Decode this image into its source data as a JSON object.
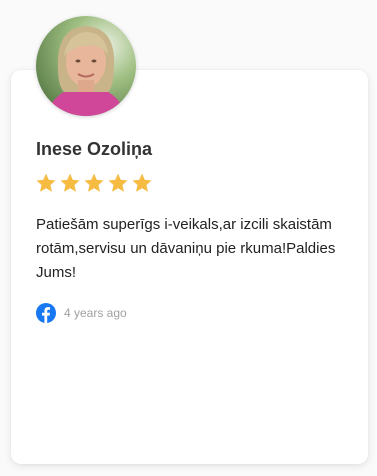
{
  "review": {
    "author_name": "Inese Ozoliņa",
    "rating": 5,
    "rating_max": 5,
    "text": "Patiešām superīgs i-veikals,ar izcili skaistām rotām,servisu un dāvaniņu pie rkuma!Paldies Jums!",
    "source_icon": "facebook-icon",
    "time_ago": "4 years ago"
  },
  "colors": {
    "star": "#f6bb42",
    "facebook": "#1877f2",
    "name": "#333333",
    "meta": "#a0a0a0"
  }
}
